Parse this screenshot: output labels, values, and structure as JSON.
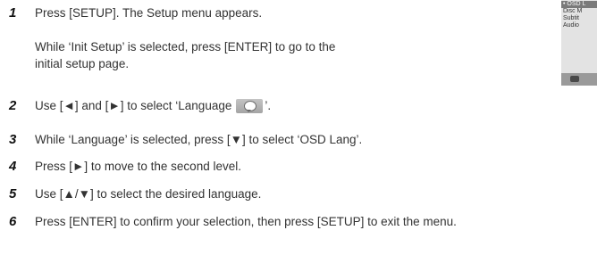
{
  "steps": [
    {
      "num": "1",
      "text": "Press [SETUP]. The Setup menu appears.",
      "sub": "While ‘Init Setup’ is selected, press [ENTER] to go to the initial setup page."
    },
    {
      "num": "2",
      "text_before": "Use [◄] and [►] to select ‘Language",
      "text_after": "’."
    },
    {
      "num": "3",
      "text": "While ‘Language’ is selected, press [▼] to select ‘OSD Lang’."
    },
    {
      "num": "4",
      "text": "Press [►] to move to the second level."
    },
    {
      "num": "5",
      "text": "Use [▲/▼] to select the desired language."
    },
    {
      "num": "6",
      "text": "Press [ENTER] to confirm your selection, then press [SETUP] to exit the menu."
    }
  ],
  "osd_menu": {
    "items": [
      "• OSD L",
      "Disc M",
      "Subtit",
      "Audio"
    ],
    "icons": [
      "language-icon",
      "left-right-arrows-icon"
    ]
  }
}
